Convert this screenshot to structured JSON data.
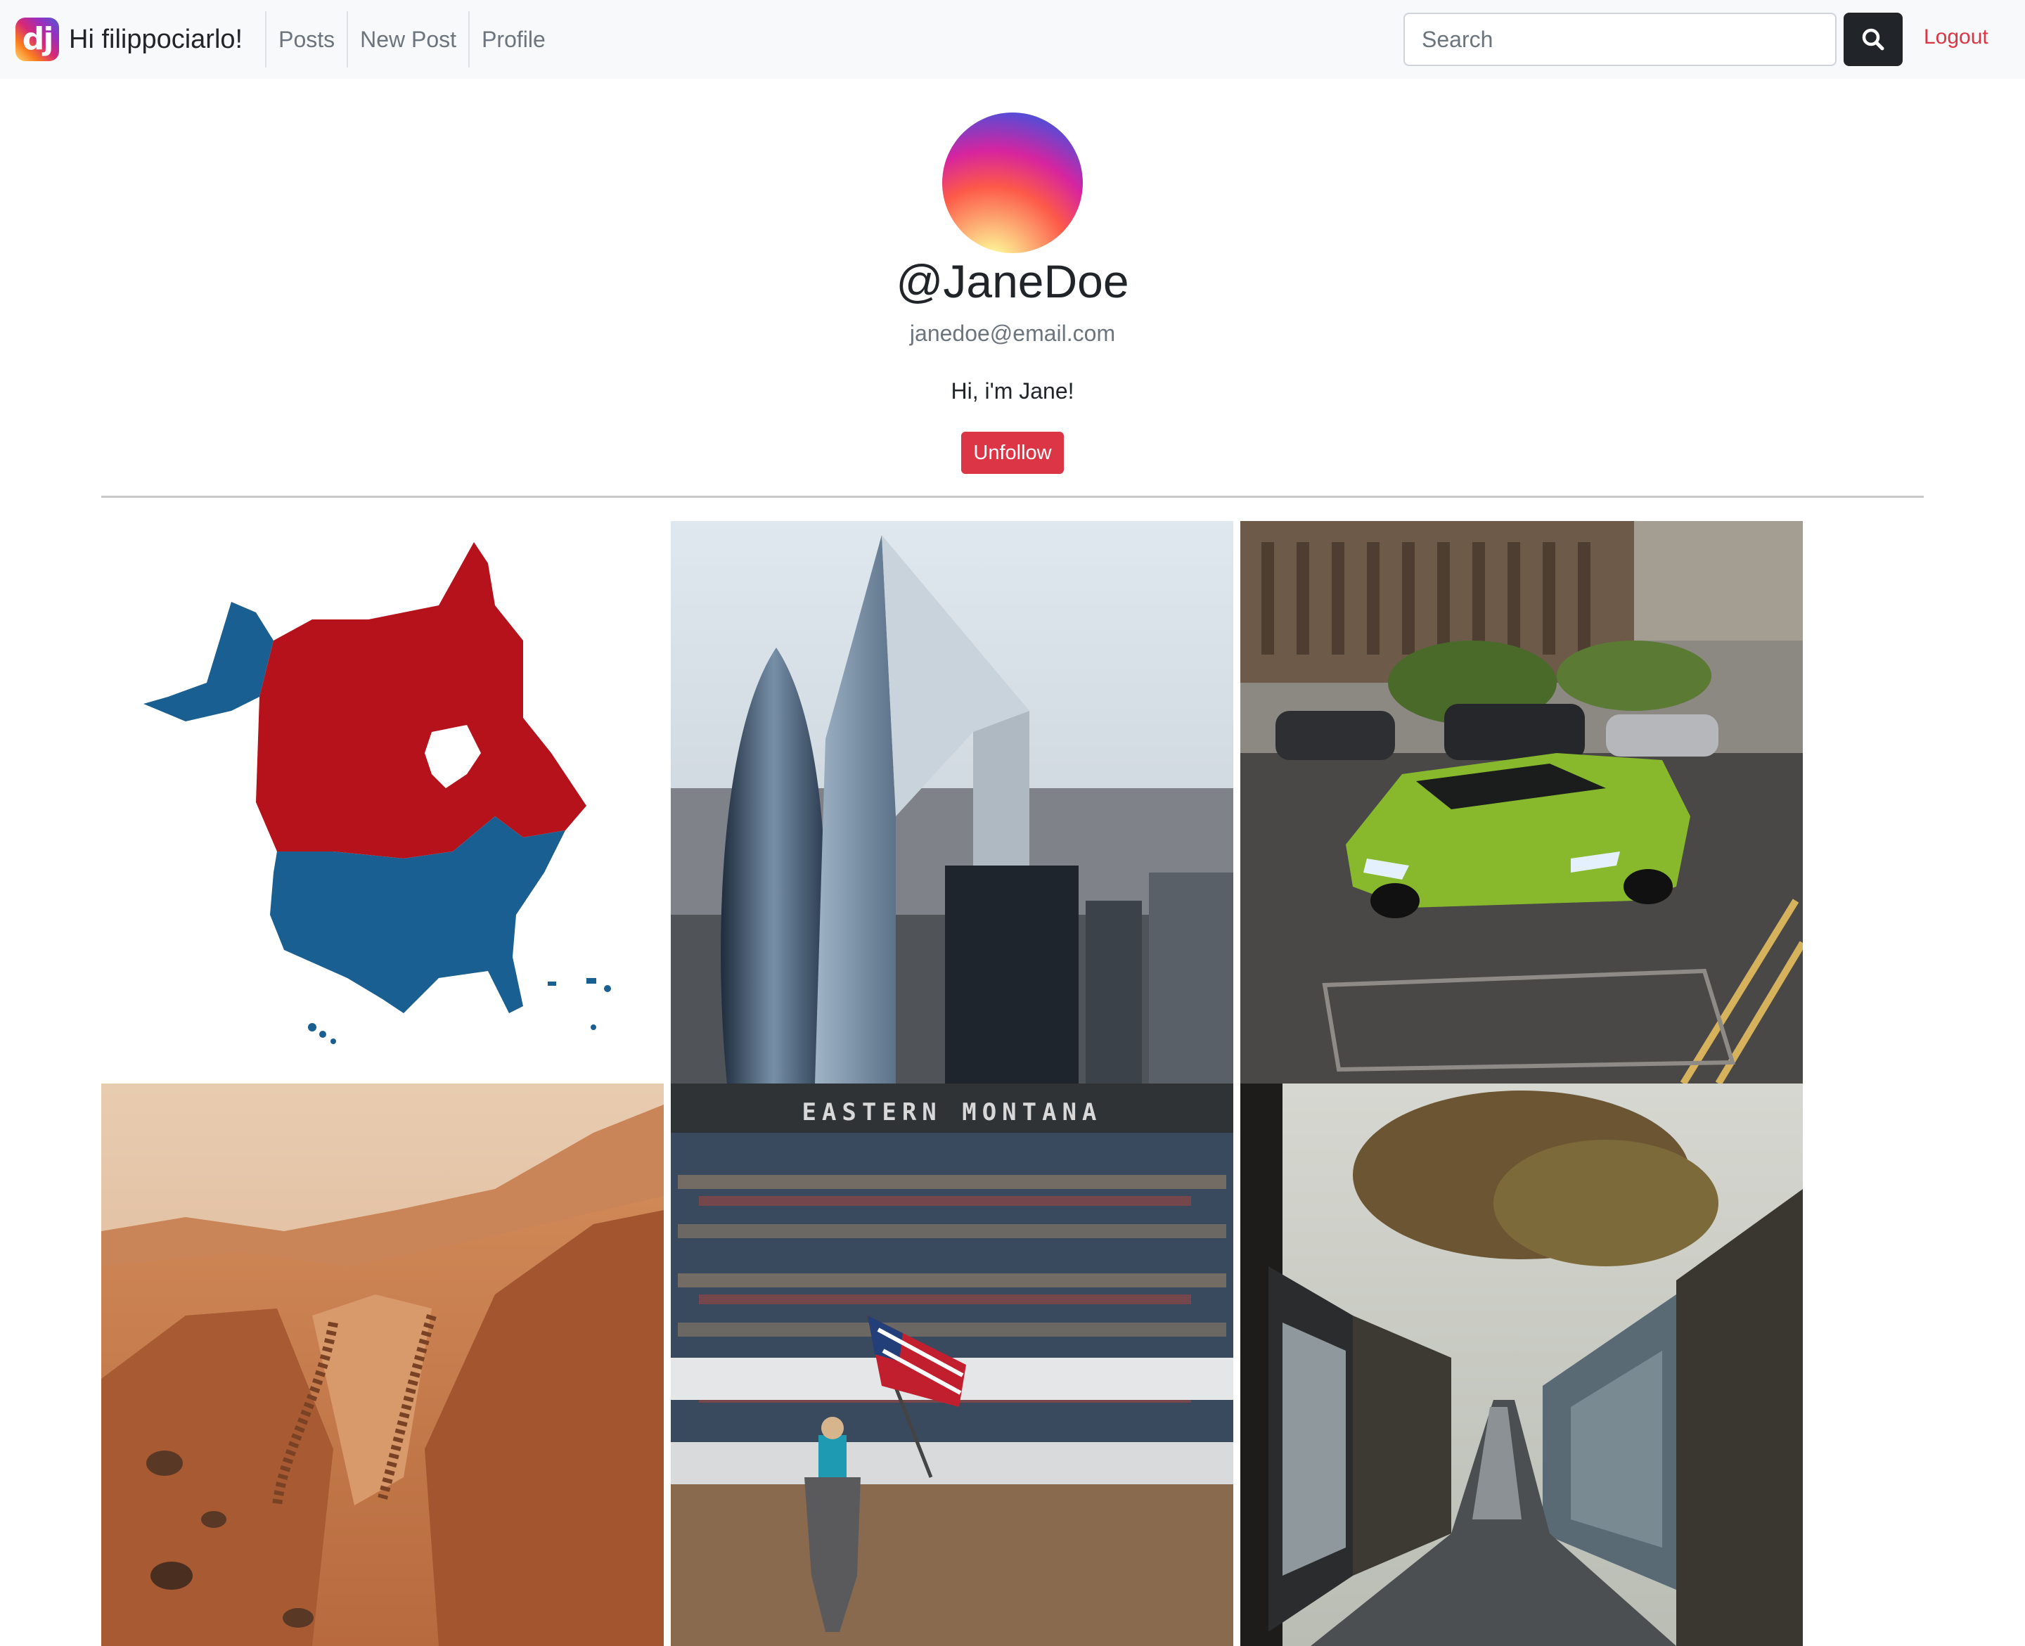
{
  "navbar": {
    "logo_text": "dj",
    "greeting": "Hi filippociarlo!",
    "links": [
      "Posts",
      "New Post",
      "Profile"
    ],
    "search_placeholder": "Search",
    "logout_label": "Logout"
  },
  "profile": {
    "username": "@JaneDoe",
    "email": "janedoe@email.com",
    "bio": "Hi, i'm Jane!",
    "unfollow_label": "Unfollow"
  },
  "posts": {
    "images": [
      "north-america-map",
      "london-skyscrapers",
      "green-lamborghini",
      "mars-desert",
      "rodeo-flag-rider",
      "urban-alley"
    ],
    "rodeo_sign": "EASTERN MONTANA"
  },
  "colors": {
    "navbar_bg": "#f8f9fa",
    "danger": "#dc3545",
    "dark": "#212529",
    "muted": "#6c757d",
    "canada_red": "#b5121b",
    "usa_blue": "#1a5f91"
  }
}
